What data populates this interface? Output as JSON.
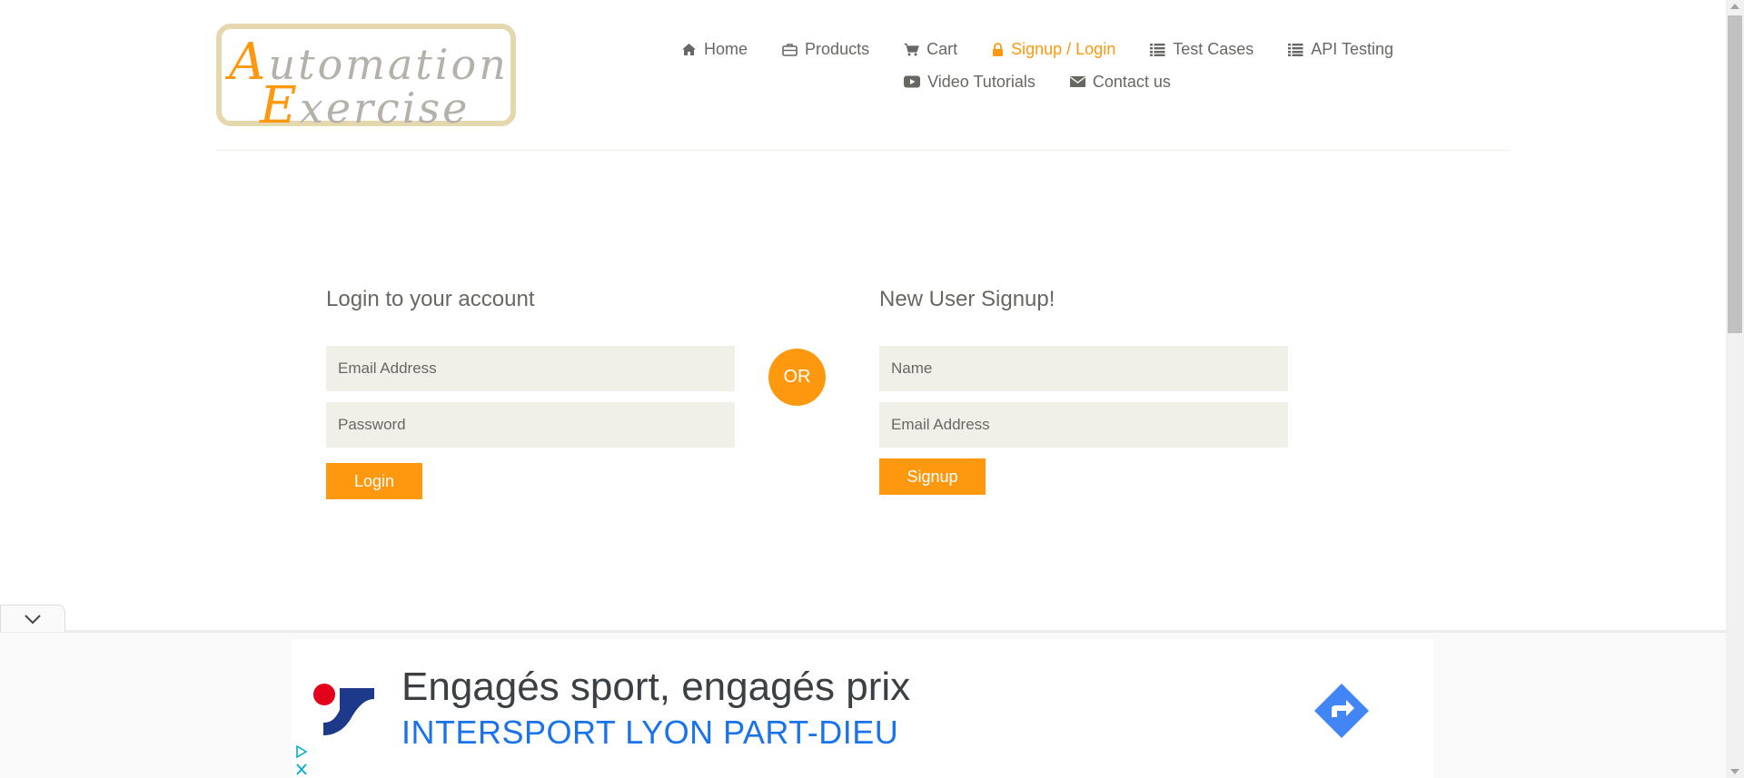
{
  "logo": {
    "line1_cap": "A",
    "line1_rest": "utomation",
    "line2_cap": "E",
    "line2_rest": "xercise"
  },
  "nav": {
    "row1": [
      {
        "label": "Home",
        "icon": "home-icon",
        "active": false
      },
      {
        "label": "Products",
        "icon": "briefcase-icon",
        "active": false
      },
      {
        "label": "Cart",
        "icon": "cart-icon",
        "active": false
      },
      {
        "label": "Signup / Login",
        "icon": "lock-icon",
        "active": true
      },
      {
        "label": "Test Cases",
        "icon": "list-icon",
        "active": false
      },
      {
        "label": "API Testing",
        "icon": "list-icon",
        "active": false
      }
    ],
    "row2": [
      {
        "label": "Video Tutorials",
        "icon": "youtube-icon",
        "active": false
      },
      {
        "label": "Contact us",
        "icon": "envelope-icon",
        "active": false
      }
    ]
  },
  "login": {
    "title": "Login to your account",
    "email_placeholder": "Email Address",
    "password_placeholder": "Password",
    "button": "Login"
  },
  "or_label": "OR",
  "signup": {
    "title": "New User Signup!",
    "name_placeholder": "Name",
    "email_placeholder": "Email Address",
    "button": "Signup"
  },
  "ad": {
    "title": "Engagés sport, engagés prix",
    "subtitle": "INTERSPORT LYON PART-DIEU"
  },
  "colors": {
    "accent": "#fe980f",
    "field_bg": "#f0f0e9",
    "text": "#696763",
    "ad_link": "#1a73e8"
  }
}
